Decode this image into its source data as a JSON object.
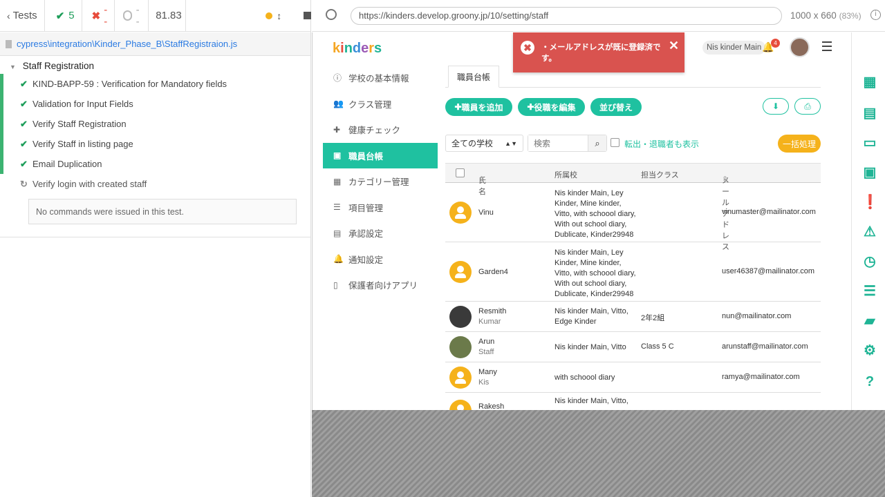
{
  "cypress": {
    "back_label": "Tests",
    "passed": "5",
    "failed": "--",
    "pending": "--",
    "duration": "81.83",
    "spec_file": "cypress\\integration\\Kinder_Phase_B\\StaffRegistraion.js",
    "suite_title": "Staff Registration",
    "tests": [
      {
        "title": "KIND-BAPP-59 : Verification for Mandatory fields",
        "state": "passed"
      },
      {
        "title": "Validation for Input Fields",
        "state": "passed"
      },
      {
        "title": "Verify Staff Registration",
        "state": "passed"
      },
      {
        "title": "Verify Staff in listing page",
        "state": "passed"
      },
      {
        "title": "Email Duplication",
        "state": "passed"
      },
      {
        "title": "Verify login with created staff",
        "state": "running"
      }
    ],
    "no_commands_text": "No commands were issued in this test."
  },
  "aut": {
    "url": "https://kinders.develop.groony.jp/10/setting/staff",
    "viewport": "1000 x 660",
    "scale": "(83%)"
  },
  "app": {
    "logo": "kinders",
    "school_badge": "Nis kinder Main",
    "notification_count": "4",
    "toast_message": "・メールアドレスが既に登録済です。",
    "sidebar": [
      {
        "label": "学校の基本情報",
        "icon": "info-icon"
      },
      {
        "label": "クラス管理",
        "icon": "users-icon"
      },
      {
        "label": "健康チェック",
        "icon": "medkit-icon"
      },
      {
        "label": "職員台帳",
        "icon": "id-card-icon",
        "active": true
      },
      {
        "label": "カテゴリー管理",
        "icon": "calendar-icon"
      },
      {
        "label": "項目管理",
        "icon": "list-icon"
      },
      {
        "label": "承認設定",
        "icon": "approve-icon"
      },
      {
        "label": "通知設定",
        "icon": "bell-icon"
      },
      {
        "label": "保護者向けアプリ",
        "icon": "mobile-icon"
      }
    ],
    "tab": "職員台帳",
    "buttons": {
      "add_staff": "職員を追加",
      "edit_role": "役職を編集",
      "sort": "並び替え",
      "bulk": "一括処理"
    },
    "filter": {
      "school_select": "全ての学校",
      "search_placeholder": "検索",
      "show_retired": "転出・退職者も表示"
    },
    "table": {
      "headers": [
        "氏名",
        "所属校",
        "担当クラス",
        "メールアドレス"
      ],
      "rows": [
        {
          "name": "Vinu",
          "sub": "",
          "avatar": "yellow",
          "school": "Nis kinder Main, Ley Kinder, Mine kinder, Vitto, with schoool diary, With out school diary, Dublicate, Kinder29948",
          "class": "",
          "email": "vinumaster@mailinator.com"
        },
        {
          "name": "Garden4",
          "sub": "",
          "avatar": "yellow",
          "school": "Nis kinder Main, Ley Kinder, Mine kinder, Vitto, with schoool diary, With out school diary, Dublicate, Kinder29948",
          "class": "",
          "email": "user46387@mailinator.com"
        },
        {
          "name": "Resmith",
          "sub": "Kumar",
          "avatar": "dark",
          "school": "Nis kinder Main, Vitto, Edge Kinder",
          "class": "2年2組",
          "email": "nun@mailinator.com"
        },
        {
          "name": "Arun",
          "sub": "Staff",
          "avatar": "photo",
          "school": "Nis kinder Main, Vitto",
          "class": "Class 5 C",
          "email": "arunstaff@mailinator.com"
        },
        {
          "name": "Many",
          "sub": "Kis",
          "avatar": "yellow",
          "school": "with schoool diary",
          "class": "",
          "email": "ramya@mailinator.com"
        },
        {
          "name": "Rakesh",
          "sub": "",
          "avatar": "yellow",
          "school": "Nis kinder Main, Vitto,",
          "class": "",
          "email": ""
        }
      ]
    }
  }
}
